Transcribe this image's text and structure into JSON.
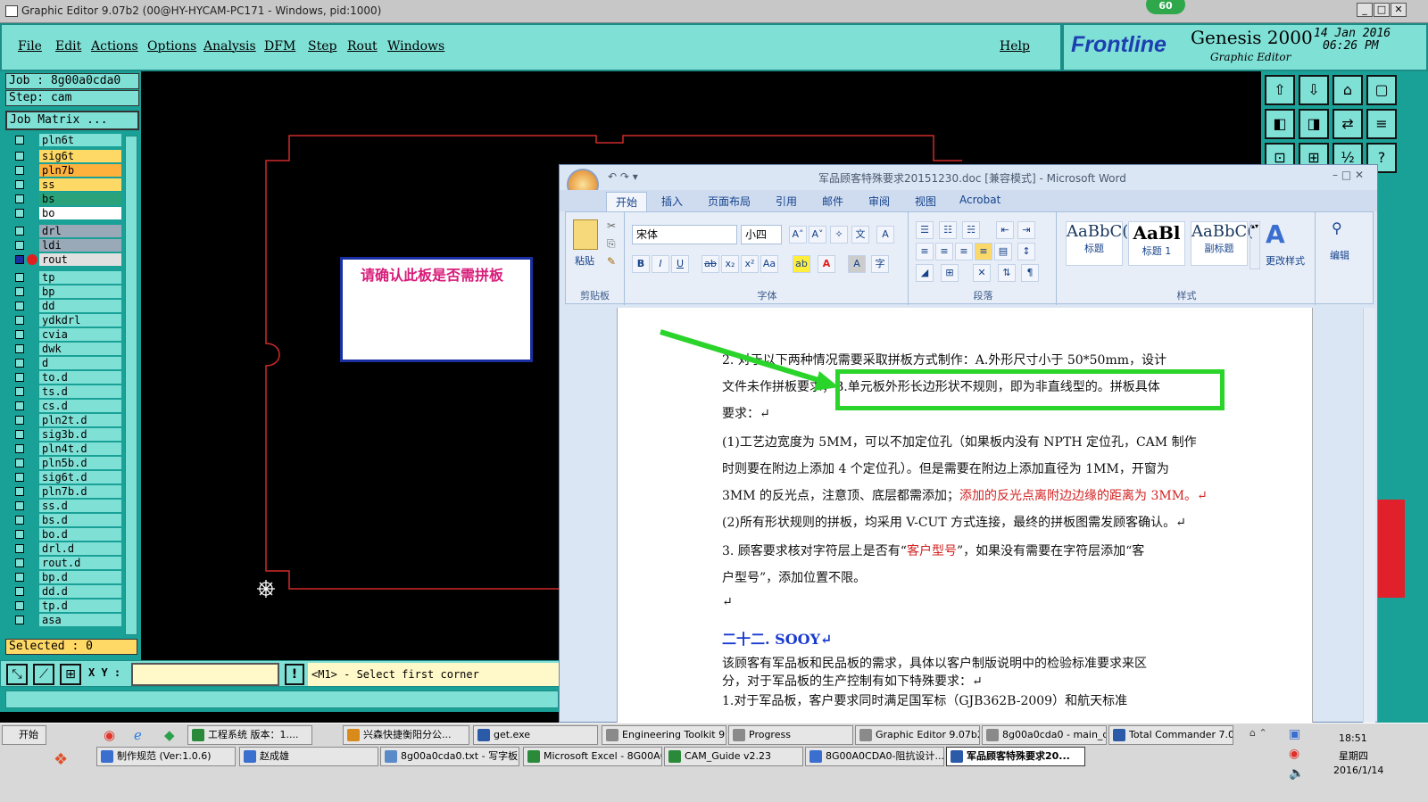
{
  "titlebar": {
    "title": "Graphic Editor 9.07b2 (00@HY-HYCAM-PC171 - Windows, pid:1000)",
    "badge": "60"
  },
  "menu": {
    "items": [
      "File",
      "Edit",
      "Actions",
      "Options",
      "Analysis",
      "DFM",
      "Step",
      "Rout",
      "Windows"
    ],
    "help": "Help"
  },
  "brand": {
    "logo": "Frontline",
    "product": "Genesis 2000",
    "subtitle": "Graphic Editor",
    "date": "14 Jan 2016",
    "time": "06:26 PM"
  },
  "job": {
    "job": "Job : 8g00a0cda0",
    "step": "Step: cam",
    "matrix": "Job Matrix ..."
  },
  "layers": [
    {
      "name": "pln6t",
      "color": "#7fe0d6"
    },
    {
      "name": "sig6t",
      "color": "#ffd966"
    },
    {
      "name": "pln7b",
      "color": "#ffb13d"
    },
    {
      "name": "ss",
      "color": "#ffd966"
    },
    {
      "name": "bs",
      "color": "#2aa37a"
    },
    {
      "name": "bo",
      "color": "#ffffff"
    },
    {
      "name": "drl",
      "color": "#9aa9b8"
    },
    {
      "name": "ldi",
      "color": "#9aa9b8"
    },
    {
      "name": "rout",
      "color": "#e0e0e0"
    },
    {
      "name": "tp",
      "color": "#7fe0d6"
    },
    {
      "name": "bp",
      "color": "#7fe0d6"
    },
    {
      "name": "dd",
      "color": "#7fe0d6"
    },
    {
      "name": "ydkdrl",
      "color": "#7fe0d6"
    },
    {
      "name": "cvia",
      "color": "#7fe0d6"
    },
    {
      "name": "dwk",
      "color": "#7fe0d6"
    },
    {
      "name": "d",
      "color": "#7fe0d6"
    },
    {
      "name": "to.d",
      "color": "#7fe0d6"
    },
    {
      "name": "ts.d",
      "color": "#7fe0d6"
    },
    {
      "name": "cs.d",
      "color": "#7fe0d6"
    },
    {
      "name": "pln2t.d",
      "color": "#7fe0d6"
    },
    {
      "name": "sig3b.d",
      "color": "#7fe0d6"
    },
    {
      "name": "pln4t.d",
      "color": "#7fe0d6"
    },
    {
      "name": "pln5b.d",
      "color": "#7fe0d6"
    },
    {
      "name": "sig6t.d",
      "color": "#7fe0d6"
    },
    {
      "name": "pln7b.d",
      "color": "#7fe0d6"
    },
    {
      "name": "ss.d",
      "color": "#7fe0d6"
    },
    {
      "name": "bs.d",
      "color": "#7fe0d6"
    },
    {
      "name": "bo.d",
      "color": "#7fe0d6"
    },
    {
      "name": "drl.d",
      "color": "#7fe0d6"
    },
    {
      "name": "rout.d",
      "color": "#7fe0d6"
    },
    {
      "name": "bp.d",
      "color": "#7fe0d6"
    },
    {
      "name": "dd.d",
      "color": "#7fe0d6"
    },
    {
      "name": "tp.d",
      "color": "#7fe0d6"
    },
    {
      "name": "asa",
      "color": "#7fe0d6"
    }
  ],
  "selected": "Selected : 0",
  "command": {
    "xy_label": "X Y :",
    "prompt": "<M1> - Select first corner"
  },
  "canvas": {
    "note": "请确认此板是否需拼板"
  },
  "word": {
    "title": "军品顾客特殊要求20151230.doc [兼容模式] - Microsoft Word",
    "tabs": [
      "开始",
      "插入",
      "页面布局",
      "引用",
      "邮件",
      "审阅",
      "视图",
      "Acrobat"
    ],
    "font": "宋体",
    "size": "小四",
    "groups": [
      "剪贴板",
      "字体",
      "段落",
      "样式",
      "编辑"
    ],
    "paste": "粘贴",
    "styles": [
      {
        "sample": "AaBbC(",
        "name": "标题"
      },
      {
        "sample": "AaBl",
        "name": "标题 1"
      },
      {
        "sample": "AaBbC(",
        "name": "副标题"
      }
    ],
    "change_styles": "更改样式",
    "edit": "编辑",
    "lines": [
      {
        "t": "2. 对于以下两种情况需要采取拼板方式制作：A.外形尺寸小于 50*50mm，设计"
      },
      {
        "t": "文件未作拼板要求；B.单元板外形长边形状不规则，即为非直线型的。拼板具体"
      },
      {
        "t": "要求：↵"
      },
      {
        "t": "(1)工艺边宽度为 5MM，可以不加定位孔（如果板内没有 NPTH 定位孔，CAM 制作"
      },
      {
        "t": "时则要在附边上添加 4 个定位孔）。但是需要在附边上添加直径为 1MM，开窗为"
      },
      {
        "t": "3MM 的反光点，注意顶、底层都需添加；",
        "red": "添加的反光点离附边边缘的距离为 3MM。↵"
      },
      {
        "t": "(2)所有形状规则的拼板，均采用 V-CUT 方式连接，最终的拼板图需发顾客确认。↵"
      },
      {
        "t": "3. 顾客要求核对字符层上是否有“",
        "red": "客户型号",
        "t2": "”，如果没有需要在字符层添加“客"
      },
      {
        "t": "户型号”，添加位置不限。"
      },
      {
        "t": "↵"
      },
      {
        "h": "二十二. SOOY↵"
      },
      {
        "t": "该顾客有军品板和民品板的需求，具体以客户制版说明中的检验标准要求来区"
      },
      {
        "t": "分，对于军品板的生产控制有如下特殊要求：↵"
      },
      {
        "t": "1.对于军品板，客户要求同时满足国军标（GJB362B-2009）和航天标准"
      }
    ]
  },
  "taskbar": {
    "start": "开始",
    "row1": [
      "工程系统 版本：1....",
      "兴森快捷衡阳分公...",
      "get.exe",
      "Engineering Toolkit 9....",
      "Progress",
      "Graphic Editor 9.07b2...",
      "8g00a0cda0 - main_qa",
      "Total Commander 7.0..."
    ],
    "row2": [
      "制作规范 (Ver:1.0.6)",
      "赵成雄",
      "8g00a0cda0.txt - 写字板",
      "Microsoft Excel - 8G00A0...",
      "CAM_Guide v2.23",
      "8G00A0CDA0-阻抗设计...",
      "军品顾客特殊要求20..."
    ],
    "clock": "18:51",
    "weekday": "星期四",
    "date": "2016/1/14"
  }
}
